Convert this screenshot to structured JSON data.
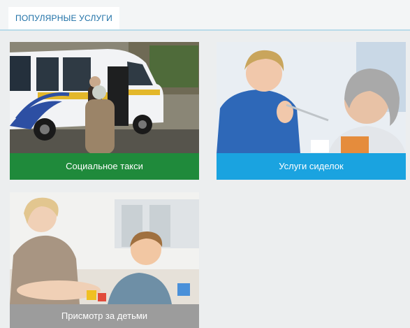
{
  "section": {
    "title": "ПОПУЛЯРНЫЕ УСЛУГИ"
  },
  "services": [
    {
      "label": "Социальное такси",
      "caption_color": "#1f8a3b"
    },
    {
      "label": "Услуги сиделок",
      "caption_color": "#1aa3e0"
    },
    {
      "label": "Присмотр за детьми",
      "caption_color": "#9c9c9c"
    }
  ]
}
